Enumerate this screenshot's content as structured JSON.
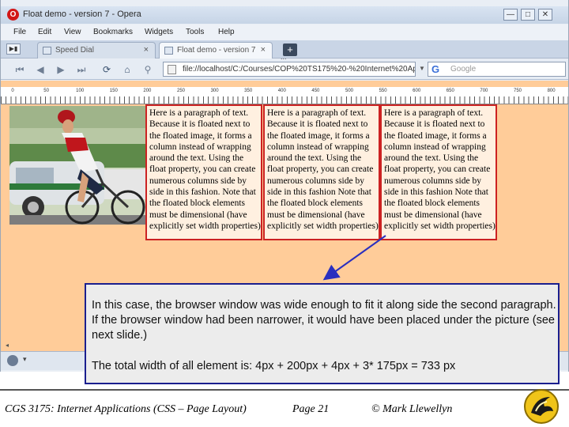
{
  "browser": {
    "window_title": "Float demo - version 7 - Opera",
    "window_controls": {
      "minimize": "—",
      "maximize": "□",
      "close": "✕"
    },
    "menu": [
      "File",
      "Edit",
      "View",
      "Bookmarks",
      "Widgets",
      "Tools",
      "Help"
    ],
    "tabs": [
      {
        "label": "Speed Dial",
        "close": "×"
      },
      {
        "label": "Float demo - version 7",
        "close": "×"
      }
    ],
    "new_tab": "+",
    "tab_overflow": "...",
    "address": "file://localhost/C:/Courses/COP%20TS175%20-%20Internet%20App",
    "search_placeholder": "Google",
    "search_logo": "G",
    "dropdown_arrow": "▼",
    "panel_caret": "▾",
    "scroll_arrow": "◂"
  },
  "ruler": {
    "labels": [
      "0",
      "50",
      "100",
      "150",
      "200",
      "250",
      "300",
      "350",
      "400",
      "450",
      "500",
      "550",
      "600",
      "650",
      "700",
      "750",
      "800"
    ]
  },
  "columns": [
    "Here is a paragraph of text. Because it is floated next to the floated image, it forms a column instead of wrapping around the text. Using the float property, you can create numerous columns side by side in this fashion. Note that the floated block elements must be dimensional (have explicitly set width properties)",
    "Here is a paragraph of text. Because it is floated next to the floated image, it forms a column instead of wrapping around the text. Using the float property, you can create numerous columns side by side in this fashion Note that the floated block elements must be dimensional (have explicitly set width properties)",
    "Here is a paragraph of text. Because it is floated next to the floated image, it forms a column instead of wrapping around the text. Using the float property, you can create numerous columns side by side in this fashion Note that the floated block elements must be dimensional (have explicitly set width properties)"
  ],
  "callout": {
    "paragraph1": "In this case, the browser window was wide enough to fit it along side the second paragraph.  If the browser window had been narrower, it would have been placed under the picture (see next slide.)",
    "paragraph2": "The total width of all element is:  4px + 200px + 4px + 3* 175px = 733 px"
  },
  "footer": {
    "course": "CGS 3175: Internet Applications (CSS – Page Layout)",
    "page": "Page 21",
    "author": "© Mark Llewellyn"
  },
  "colors": {
    "page_bg": "#ffcc99",
    "column_border": "#cc2222",
    "callout_border": "#1a1f8f",
    "arrow": "#2a2fbf"
  },
  "icons": [
    "opera-logo-icon",
    "back-icon",
    "forward-icon",
    "rewind-icon",
    "fast-forward-icon",
    "reload-icon",
    "home-icon",
    "wand-icon",
    "google-icon",
    "ucf-pegasus-logo"
  ]
}
